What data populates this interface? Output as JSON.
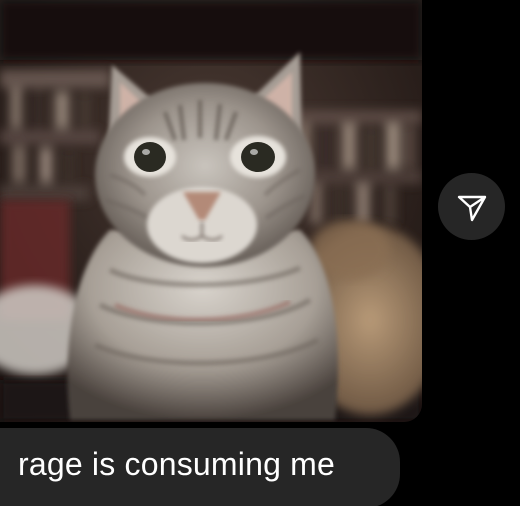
{
  "chat": {
    "media_message": {
      "image_subject": "tabby cat photo",
      "share_icon": "send-arrow-icon"
    },
    "text_message": "rage is consuming me"
  },
  "colors": {
    "background": "#000000",
    "bubble": "#262626",
    "text": "#ffffff"
  }
}
